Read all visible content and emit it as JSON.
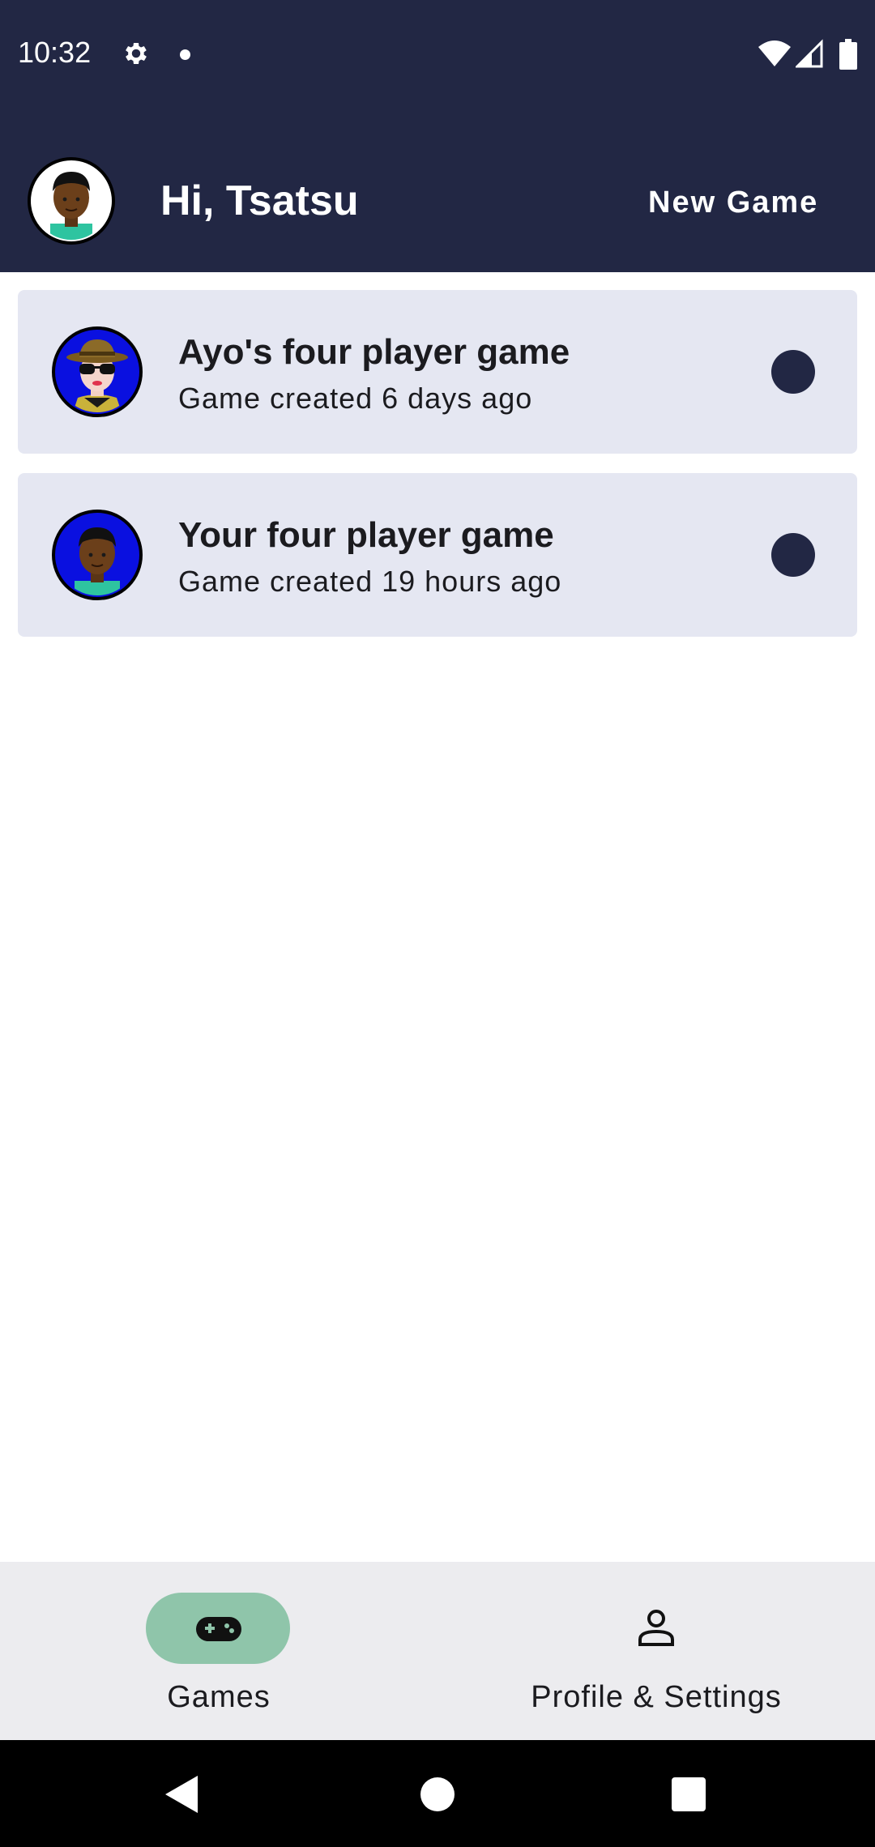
{
  "status_bar": {
    "time": "10:32",
    "icons": [
      "gear-icon",
      "notification-dot-icon",
      "wifi-icon",
      "signal-icon",
      "battery-icon"
    ]
  },
  "header": {
    "greeting": "Hi, Tsatsu",
    "new_game_label": "New Game",
    "avatar": "user-avatar"
  },
  "games": [
    {
      "title": "Ayo's four player game",
      "subtitle": "Game created 6 days ago",
      "avatar": "avatar-hat-sunglasses"
    },
    {
      "title": "Your four player game",
      "subtitle": "Game created 19 hours ago",
      "avatar": "avatar-user"
    }
  ],
  "bottom_nav": {
    "items": [
      {
        "label": "Games",
        "icon": "gamepad-icon",
        "selected": true
      },
      {
        "label": "Profile & Settings",
        "icon": "person-icon",
        "selected": false
      }
    ]
  },
  "colors": {
    "app_bar": "#222744",
    "card_background": "#e5e7f2",
    "status_dot": "#222744",
    "nav_background": "#ececef",
    "nav_selected_pill": "#8fc5aa"
  }
}
